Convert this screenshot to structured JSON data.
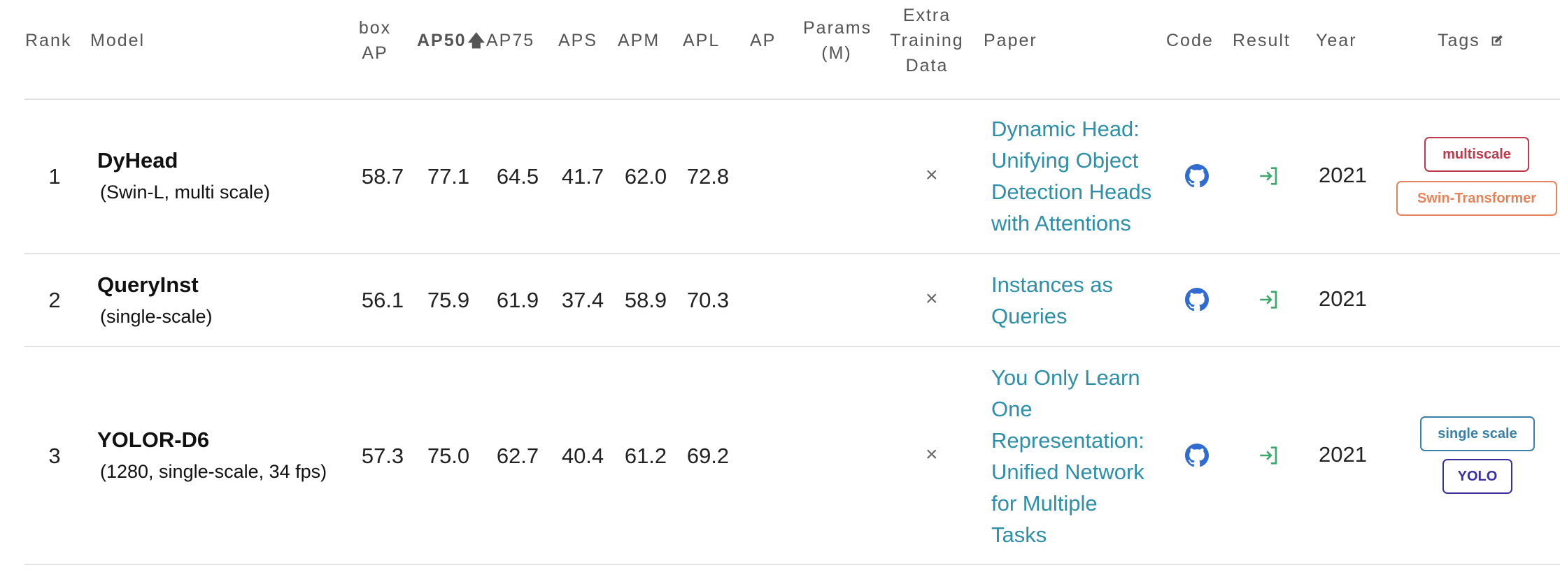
{
  "header": {
    "rank": "Rank",
    "model": "Model",
    "box_ap_1": "box",
    "box_ap_2": "AP",
    "ap50": "AP50",
    "ap75": "AP75",
    "aps": "APS",
    "apm": "APM",
    "apl": "APL",
    "ap": "AP",
    "params_1": "Params",
    "params_2": "(M)",
    "extra_1": "Extra",
    "extra_2": "Training",
    "extra_3": "Data",
    "paper": "Paper",
    "code": "Code",
    "result": "Result",
    "year": "Year",
    "tags": "Tags",
    "sort_icon": "arrow-up-icon",
    "tags_edit_icon": "edit-icon"
  },
  "rows": [
    {
      "rank": "1",
      "model_name": "DyHead",
      "model_variant": "(Swin-L, multi scale)",
      "box_ap": "58.7",
      "ap50": "77.1",
      "ap75": "64.5",
      "aps": "41.7",
      "apm": "62.0",
      "apl": "72.8",
      "extra": "×",
      "paper": "Dynamic Head: Unifying Object Detection Heads with Attentions",
      "year": "2021",
      "tags": [
        {
          "label": "multiscale",
          "color": "#c0394b"
        },
        {
          "label": "Swin-Transformer",
          "color": "#e8825a"
        }
      ]
    },
    {
      "rank": "2",
      "model_name": "QueryInst",
      "model_variant": "(single-scale)",
      "box_ap": "56.1",
      "ap50": "75.9",
      "ap75": "61.9",
      "aps": "37.4",
      "apm": "58.9",
      "apl": "70.3",
      "extra": "×",
      "paper": "Instances as Queries",
      "year": "2021",
      "tags": []
    },
    {
      "rank": "3",
      "model_name": "YOLOR-D6",
      "model_variant": "(1280, single-scale, 34 fps)",
      "box_ap": "57.3",
      "ap50": "75.0",
      "ap75": "62.7",
      "aps": "40.4",
      "apm": "61.2",
      "apl": "69.2",
      "extra": "×",
      "paper": "You Only Learn One Representation: Unified Network for Multiple Tasks",
      "year": "2021",
      "tags": [
        {
          "label": "single scale",
          "color": "#3a7fa8"
        },
        {
          "label": "YOLO",
          "color": "#3a2fa0"
        }
      ]
    }
  ],
  "icons": {
    "code": "github-icon",
    "result": "sign-in-arrow-icon"
  },
  "colors": {
    "paper_link": "#2e8fa8",
    "github_icon": "#2f6bd0",
    "result_icon": "#3aa86a"
  }
}
